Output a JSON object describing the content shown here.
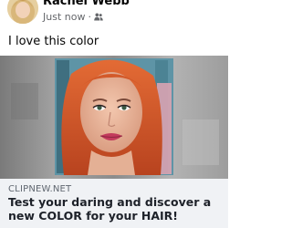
{
  "post": {
    "author": "Rachel Webb",
    "timestamp": "Just now",
    "separator": "·",
    "audience_icon": "friends-icon",
    "text": "I love this color"
  },
  "link_preview": {
    "domain": "CLIPNEW.NET",
    "title": "Test your daring and discover a new COLOR for your HAIR!"
  },
  "colors": {
    "hair": "#d85b2c",
    "lips": "#c23a5c",
    "link_box_bg": "#f0f2f5",
    "meta_text": "#65676b"
  }
}
